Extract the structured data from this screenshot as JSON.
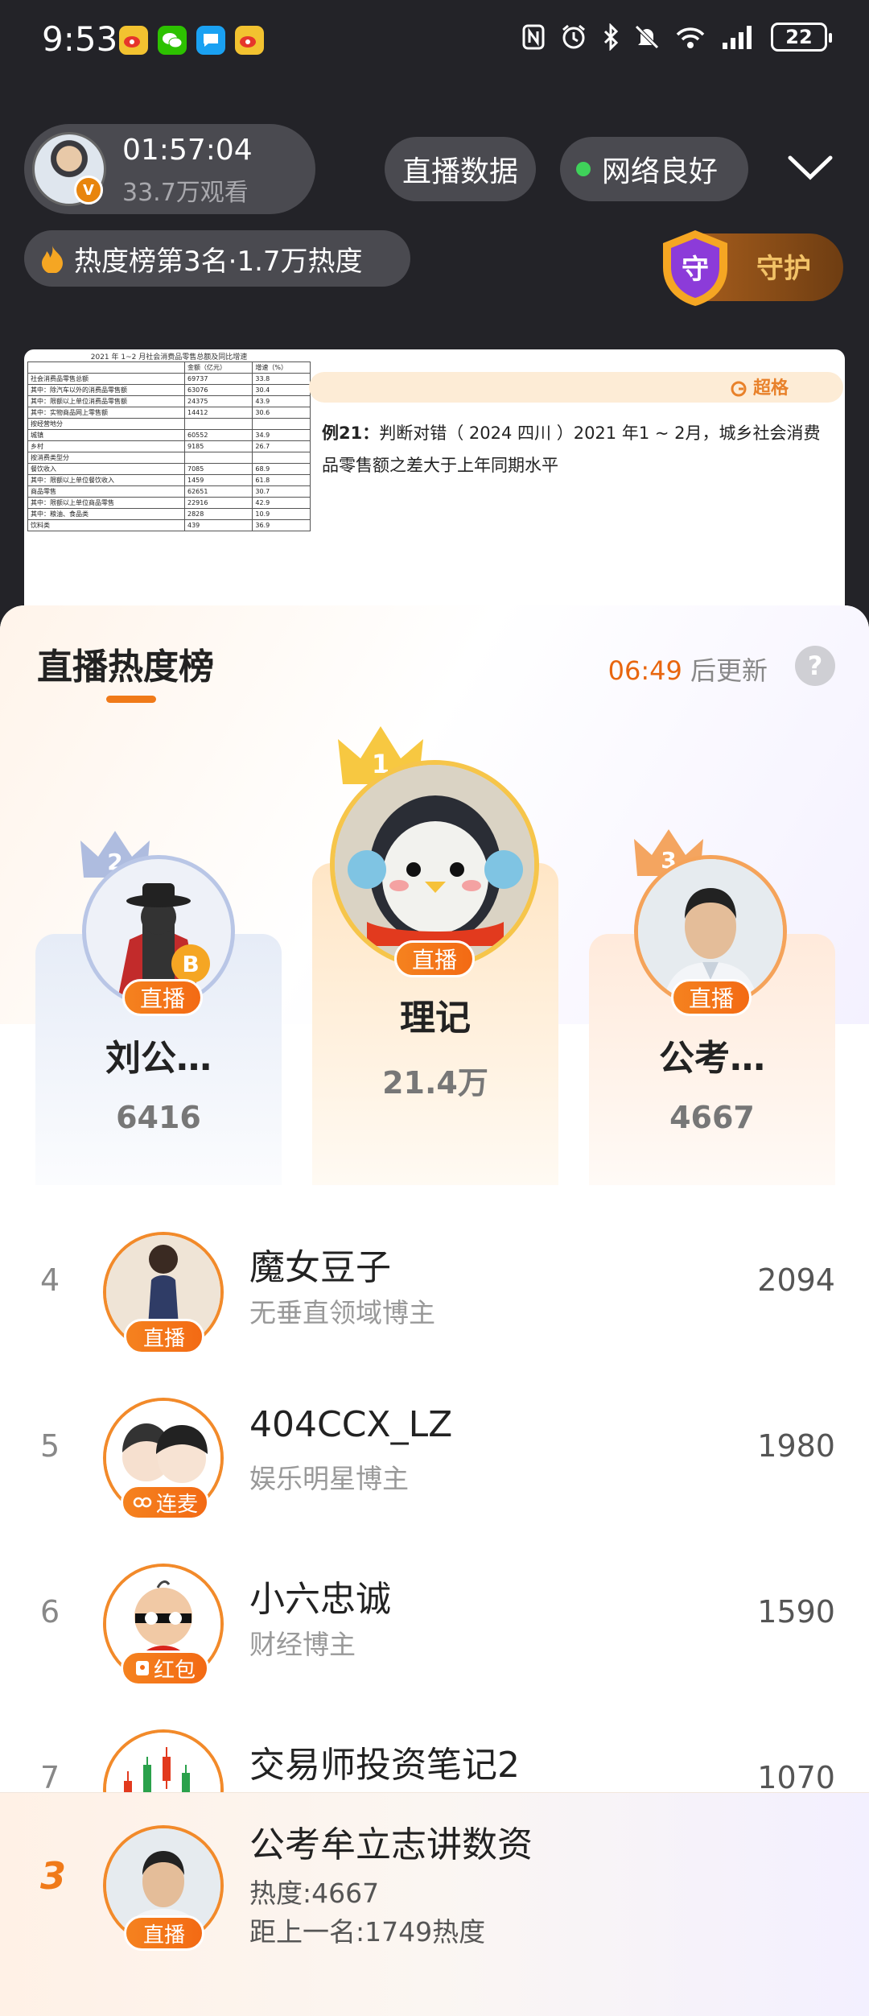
{
  "status_bar": {
    "time": "9:53",
    "battery": "22"
  },
  "live_header": {
    "duration": "01:57:04",
    "viewers": "33.7万观看",
    "live_data_label": "直播数据",
    "network_label": "网络良好",
    "heat_rank_text": "热度榜第3名·1.7万热度",
    "guard_label": "守护",
    "guard_shield_char": "守"
  },
  "lesson": {
    "table_caption": "2021 年 1~2 月社会消费品零售总额及同比增速",
    "table_headers": [
      "",
      "金额（亿元）",
      "增速（%）"
    ],
    "table_rows": [
      [
        "社会消费品零售总额",
        "69737",
        "33.8"
      ],
      [
        "其中：除汽车以外的消费品零售额",
        "63076",
        "30.4"
      ],
      [
        "其中：限额以上单位消费品零售额",
        "24375",
        "43.9"
      ],
      [
        "其中：实物商品网上零售额",
        "14412",
        "30.6"
      ],
      [
        "按经营地分",
        "",
        ""
      ],
      [
        "城镇",
        "60552",
        "34.9"
      ],
      [
        "乡村",
        "9185",
        "26.7"
      ],
      [
        "按消费类型分",
        "",
        ""
      ],
      [
        "餐饮收入",
        "7085",
        "68.9"
      ],
      [
        "其中：限额以上单位餐饮收入",
        "1459",
        "61.8"
      ],
      [
        "商品零售",
        "62651",
        "30.7"
      ],
      [
        "其中：限额以上单位商品零售",
        "22916",
        "42.9"
      ],
      [
        "其中：粮油、食品类",
        "2828",
        "10.9"
      ],
      [
        "饮料类",
        "439",
        "36.9"
      ]
    ],
    "stamp": "超格",
    "question_label": "例21：",
    "question_text": "判断对错（ 2024 四川 ）2021 年1 ~ 2月，城乡社会消费品零售额之差大于上年同期水平"
  },
  "ranking": {
    "title": "直播热度榜",
    "update_time": "06:49",
    "update_suffix": " 后更新",
    "help": "?",
    "podium": [
      {
        "rank": "2",
        "name": "刘公…",
        "score": "6416",
        "tag": "直播"
      },
      {
        "rank": "1",
        "name": "理记",
        "score": "21.4万",
        "tag": "直播"
      },
      {
        "rank": "3",
        "name": "公考…",
        "score": "4667",
        "tag": "直播"
      }
    ],
    "list": [
      {
        "rank": "4",
        "name": "魔女豆子",
        "desc": "无垂直领域博主",
        "score": "2094",
        "tag": "直播"
      },
      {
        "rank": "5",
        "name": "404CCX_LZ",
        "desc": "娱乐明星博主",
        "score": "1980",
        "tag": "连麦"
      },
      {
        "rank": "6",
        "name": "小六忠诚",
        "desc": "财经博主",
        "score": "1590",
        "tag": "红包"
      },
      {
        "rank": "7",
        "name": "交易师投资笔记2",
        "desc": "",
        "score": "1070",
        "tag": ""
      }
    ],
    "my_rank": {
      "rank": "3",
      "name": "公考牟立志讲数资",
      "heat": "热度:4667",
      "gap": "距上一名:1749热度",
      "tag": "直播"
    }
  }
}
